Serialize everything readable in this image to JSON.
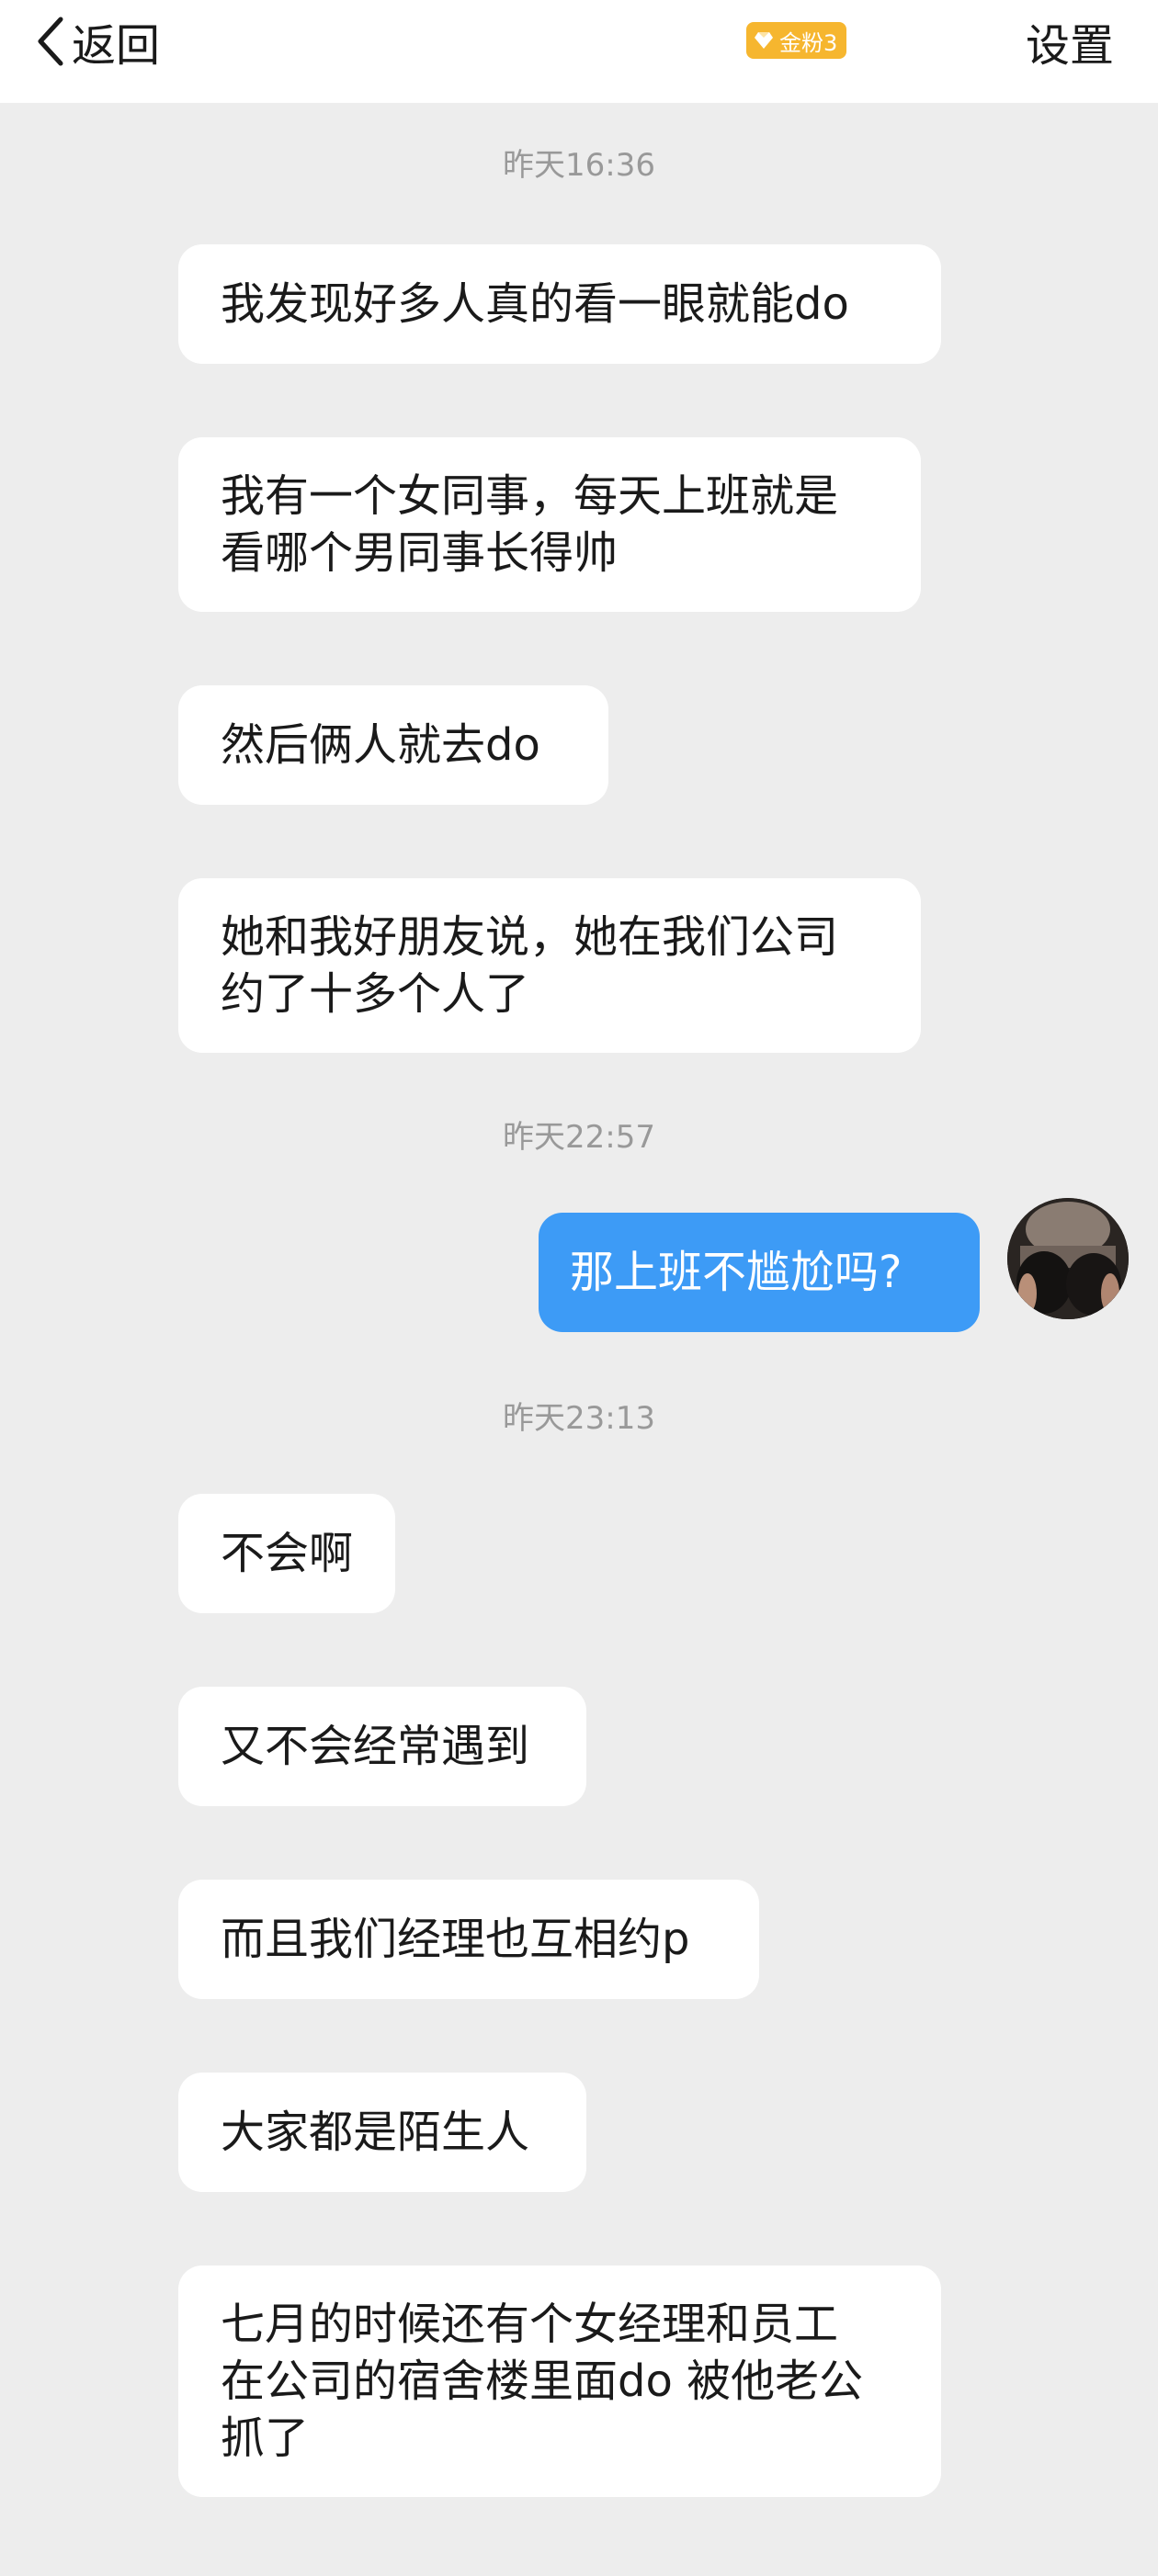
{
  "header": {
    "back_label": "返回",
    "badge_label": "金粉3",
    "settings_label": "设置"
  },
  "messages": [
    {
      "type": "timestamp",
      "text": "昨天16:36"
    },
    {
      "type": "received",
      "text": "我发现好多人真的看一眼就能do"
    },
    {
      "type": "received",
      "lines": [
        "我有一个女同事，每天上班就是",
        "看哪个男同事长得帅"
      ]
    },
    {
      "type": "received",
      "text": "然后俩人就去do"
    },
    {
      "type": "received",
      "lines": [
        "她和我好朋友说，她在我们公司",
        "约了十多个人了"
      ]
    },
    {
      "type": "timestamp",
      "text": "昨天22:57"
    },
    {
      "type": "sent",
      "text": "那上班不尴尬吗?"
    },
    {
      "type": "timestamp",
      "text": "昨天23:13"
    },
    {
      "type": "received",
      "text": "不会啊"
    },
    {
      "type": "received",
      "text": "又不会经常遇到"
    },
    {
      "type": "received",
      "text": "而且我们经理也互相约p"
    },
    {
      "type": "received",
      "text": "大家都是陌生人"
    },
    {
      "type": "received",
      "lines": [
        "七月的时候还有个女经理和员工",
        "在公司的宿舍楼里面do 被他老公",
        "抓了"
      ]
    }
  ],
  "colors": {
    "background": "#ededed",
    "received_bubble": "#ffffff",
    "sent_bubble": "#3d9bf6",
    "badge": "#f6b62f",
    "timestamp_text": "#999999"
  },
  "icons": {
    "back": "chevron-left-icon",
    "badge": "gem-icon"
  }
}
